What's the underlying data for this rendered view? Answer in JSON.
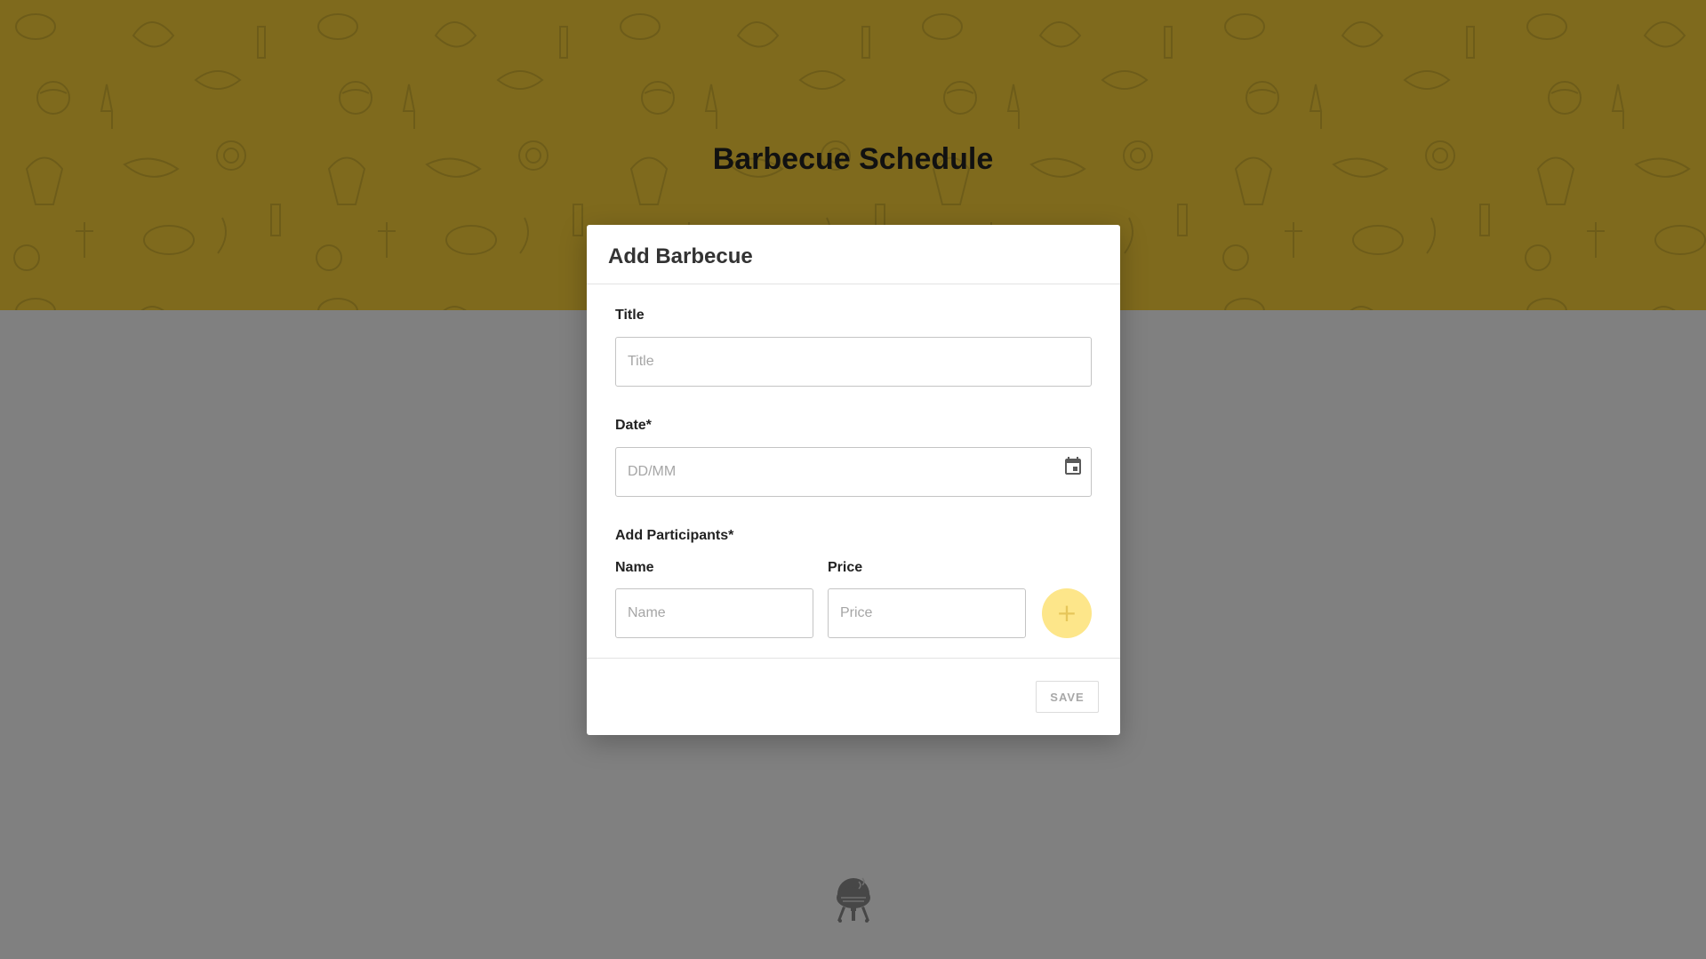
{
  "page": {
    "title": "Barbecue Schedule",
    "header_color": "#7f6a1d",
    "overlay_color": "#808080"
  },
  "modal": {
    "title": "Add Barbecue",
    "fields": {
      "title_label": "Title",
      "title_placeholder": "Title",
      "title_value": "",
      "date_label": "Date*",
      "date_placeholder": "DD/MM",
      "date_value": "",
      "participants_label": "Add Participants*",
      "name_label": "Name",
      "name_placeholder": "Name",
      "price_label": "Price",
      "price_placeholder": "Price"
    },
    "add_button_symbol": "+",
    "save_label": "SAVE",
    "accent_color": "#fde68a"
  },
  "icons": {
    "calendar": "calendar-icon",
    "add": "plus-icon",
    "logo": "barbecue-grill-icon"
  }
}
